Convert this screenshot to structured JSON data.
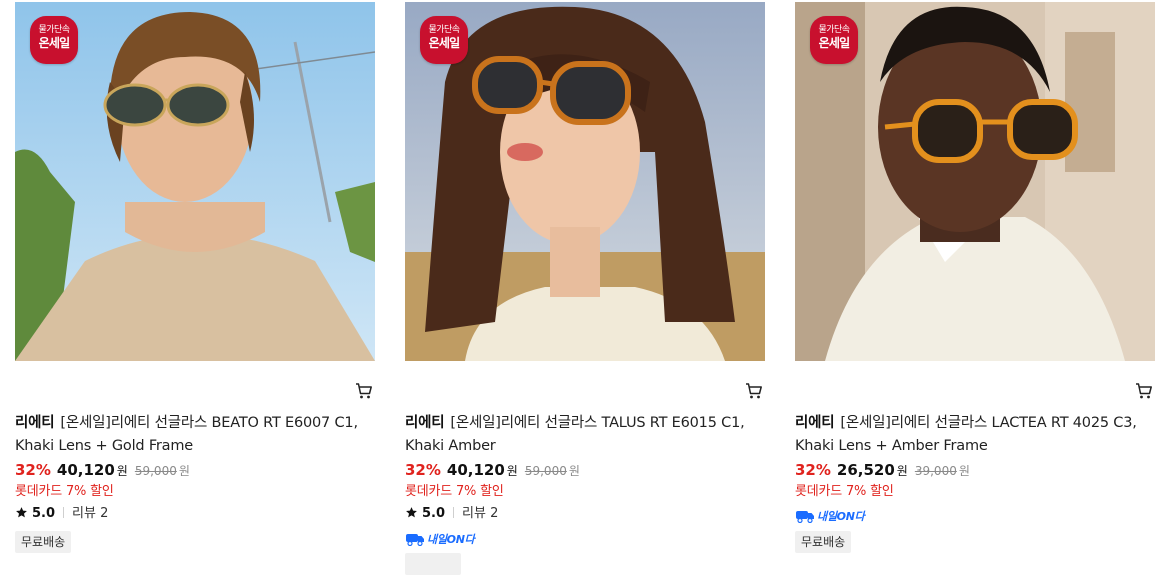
{
  "products": [
    {
      "badge_line1": "물가단속",
      "badge_line2": "온세일",
      "brand": "리에티",
      "name": "[온세일]리에티 선글라스 BEATO RT E6007 C1, Khaki Lens + Gold Frame",
      "discount": "32%",
      "price": "40,120",
      "price_unit": "원",
      "original_price": "59,000",
      "original_unit": "원",
      "card_discount": "롯데카드 7% 할인",
      "rating": "5.0",
      "reviews": "리뷰 2",
      "shipping": "무료배송"
    },
    {
      "badge_line1": "물가단속",
      "badge_line2": "온세일",
      "brand": "리에티",
      "name": "[온세일]리에티 선글라스 TALUS RT E6015 C1, Khaki Amber",
      "discount": "32%",
      "price": "40,120",
      "price_unit": "원",
      "original_price": "59,000",
      "original_unit": "원",
      "card_discount": "롯데카드 7% 할인",
      "rating": "5.0",
      "reviews": "리뷰 2",
      "delivery_badge": "내일ON다"
    },
    {
      "badge_line1": "물가단속",
      "badge_line2": "온세일",
      "brand": "리에티",
      "name": "[온세일]리에티 선글라스 LACTEA RT 4025 C3, Khaki Lens + Amber Frame",
      "discount": "32%",
      "price": "26,520",
      "price_unit": "원",
      "original_price": "39,000",
      "original_unit": "원",
      "card_discount": "롯데카드 7% 할인",
      "delivery_badge": "내일ON다",
      "shipping": "무료배송"
    }
  ],
  "icons": {
    "cart": "cart-icon",
    "star": "star-icon",
    "delivery": "delivery-truck-icon"
  },
  "colors": {
    "discount": "#e0231e",
    "badge_bg": "#c8102e",
    "delivery_blue": "#1a6cff",
    "chip_bg": "#f0f0f0"
  }
}
